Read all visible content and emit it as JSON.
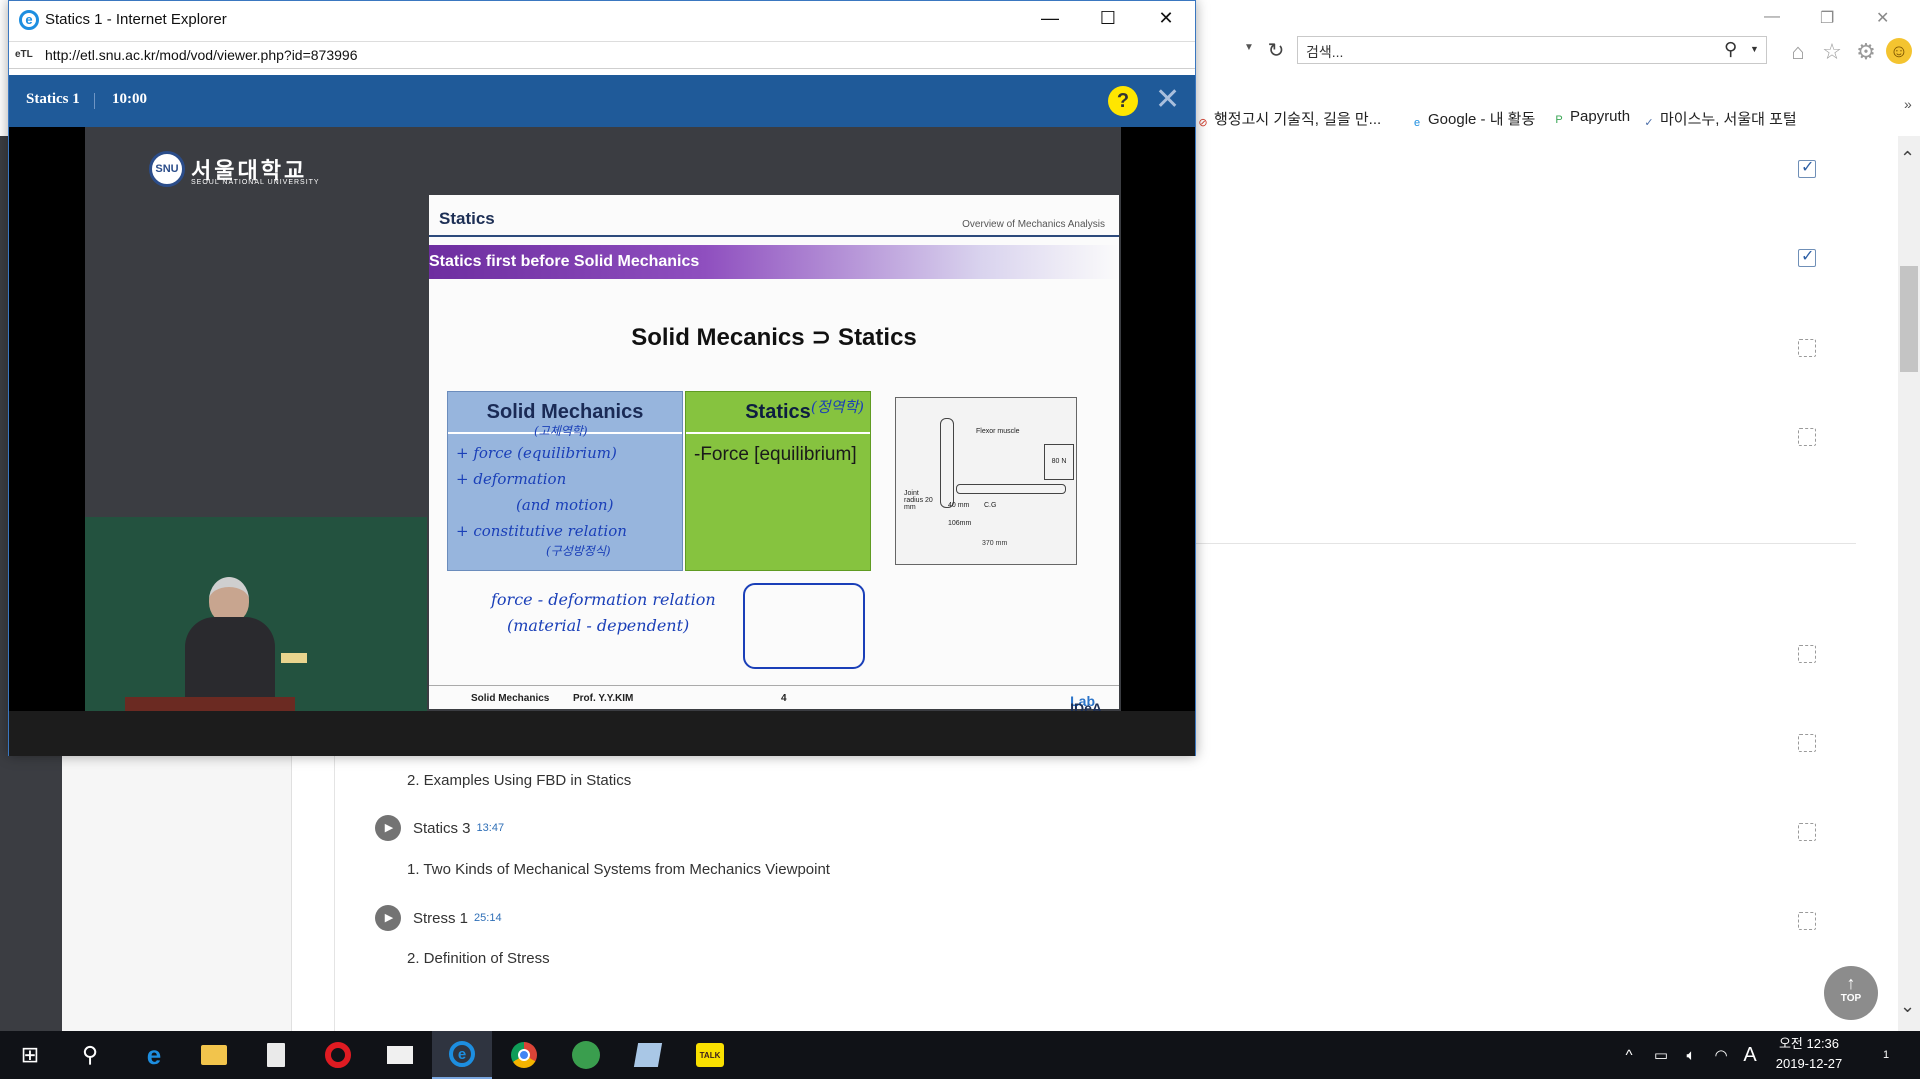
{
  "popup": {
    "title": "Statics 1 - Internet Explorer",
    "url": "http://etl.snu.ac.kr/mod/vod/viewer.php?id=873996",
    "address_icon": "eTL",
    "minimize_icon": "—",
    "maximize_icon": "☐",
    "close_icon": "✕"
  },
  "player": {
    "title": "Statics 1",
    "duration": "10:00",
    "help_label": "?",
    "close_label": "✕"
  },
  "video": {
    "university_name": "서울대학교",
    "university_subtitle": "SEOUL NATIONAL UNIVERSITY",
    "slide": {
      "header": "Statics",
      "header_right": "Overview of Mechanics Analysis",
      "band": "Statics first before Solid Mechanics",
      "formula": "Solid Mecanics ⊃ Statics",
      "col1_header": "Solid Mechanics",
      "col1_note": "(고체역학)",
      "col1_lines": [
        "+ force (equilibrium)",
        "+ deformation",
        "(and motion)",
        "+ constitutive relation",
        "(구성방정식)"
      ],
      "col2_header": "Statics",
      "col2_note": "(정역학)",
      "col2_text": "-Force [equilibrium]",
      "diagram_labels": {
        "muscle": "Flexor muscle",
        "weight": "80 N",
        "joint": "Joint radius 20 mm",
        "d1": "40 mm",
        "d2": "106mm",
        "d3": "370 mm",
        "cg": "C.G"
      },
      "bottom_note_1": "force - deformation relation",
      "bottom_note_2": "(material - dependent)",
      "footer_course": "Solid Mechanics",
      "footer_prof": "Prof. Y.Y.KIM",
      "footer_page": "4",
      "footer_lab_a": "IDeA",
      "footer_lab_b": "Lab"
    }
  },
  "browser_bg": {
    "search_placeholder": "검색...",
    "favorites": [
      {
        "label": "행정고시 기술직, 길을 만...",
        "icon": "⊘",
        "color": "#d23a2a"
      },
      {
        "label": "Google - 내 활동",
        "icon": "e",
        "color": "#1d8ee0"
      },
      {
        "label": "Papyruth",
        "icon": "P",
        "color": "#3aa655"
      },
      {
        "label": "마이스누, 서울대 포털",
        "icon": "✓",
        "color": "#4a6da8"
      }
    ],
    "more_icon": "»"
  },
  "page": {
    "checkboxes": [
      true,
      true,
      false,
      false,
      false,
      false,
      false,
      false
    ],
    "lessons": [
      {
        "sub_above": "2. Examples Using FBD in Statics"
      },
      {
        "title": "Statics 3",
        "duration": "13:47",
        "sub": "1. Two Kinds of Mechanical Systems from Mechanics Viewpoint"
      },
      {
        "title": "Stress 1",
        "duration": "25:14",
        "sub": "2. Definition of Stress"
      }
    ],
    "top_button": "TOP",
    "top_arrow": "↑"
  },
  "taskbar": {
    "clock_time": "오전 12:36",
    "clock_date": "2019-12-27",
    "ime": "A",
    "notifications": "1",
    "talk_label": "TALK"
  }
}
